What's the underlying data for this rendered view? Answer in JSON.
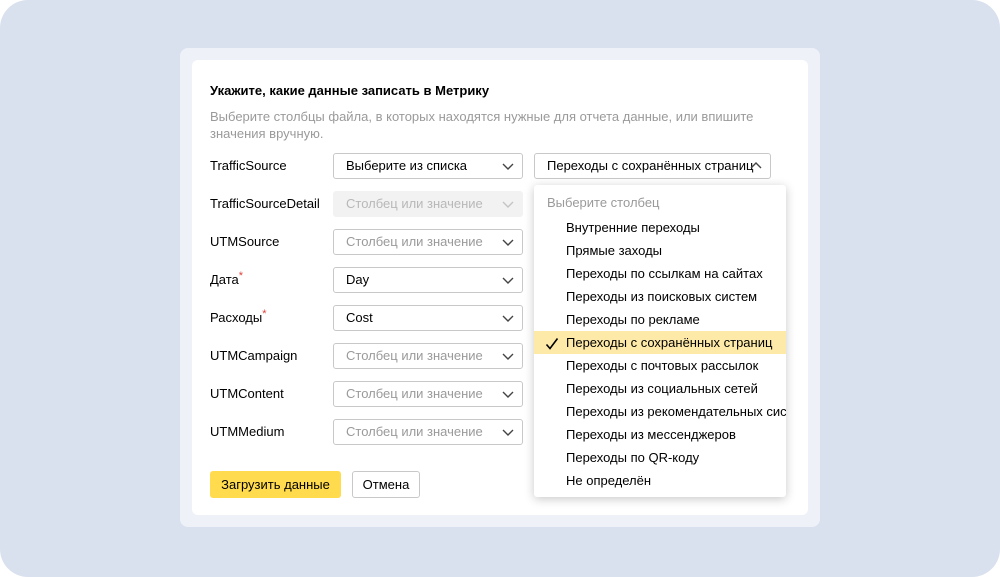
{
  "heading": "Укажите, какие данные записать в Метрику",
  "description": "Выберите столбцы файла, в которых находятся нужные для отчета данные, или впишите значения вручную.",
  "rows": [
    {
      "label": "TrafficSource",
      "required": "",
      "value": "Выберите из списка"
    },
    {
      "label": "TrafficSourceDetail",
      "required": "",
      "value": "Столбец или значение"
    },
    {
      "label": "UTMSource",
      "required": "",
      "value": "Столбец или значение"
    },
    {
      "label": "Дата",
      "required": "*",
      "value": "Day"
    },
    {
      "label": "Расходы",
      "required": "*",
      "value": "Cost"
    },
    {
      "label": "UTMCampaign",
      "required": "",
      "value": "Столбец или значение"
    },
    {
      "label": "UTMContent",
      "required": "",
      "value": "Столбец или значение"
    },
    {
      "label": "UTMMedium",
      "required": "",
      "value": "Столбец или значение"
    }
  ],
  "traffic_value_select": "Переходы с сохранённых страниц",
  "dropdown": {
    "header": "Выберите столбец",
    "items": [
      "Внутренние переходы",
      "Прямые заходы",
      "Переходы по ссылкам на сайтах",
      "Переходы из поисковых систем",
      "Переходы по рекламе",
      "Переходы с сохранённых страниц",
      "Переходы с почтовых рассылок",
      "Переходы из социальных сетей",
      "Переходы из рекомендательных систем",
      "Переходы из мессенджеров",
      "Переходы по QR-коду",
      "Не определён"
    ],
    "selected_item": "Переходы с сохранённых страниц"
  },
  "buttons": {
    "submit": "Загрузить данные",
    "cancel": "Отмена"
  },
  "colors": {
    "accent": "#ffdb4d",
    "selected_bg": "#fdeaa8",
    "required": "#e0413a"
  }
}
